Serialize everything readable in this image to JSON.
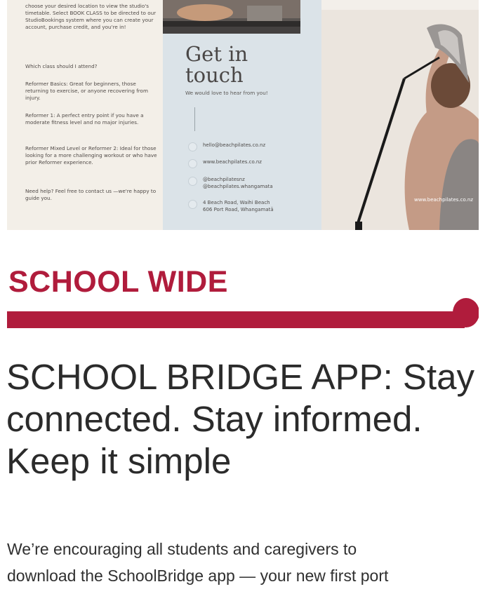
{
  "flyer": {
    "left_paragraphs": [
      "choose your desired location to view the studio's timetable. Select BOOK CLASS to be directed to our StudioBookings system where you can create your account, purchase credit, and you're in!",
      "Which class should I attend?",
      "Reformer Basics: Great for beginners, those returning to exercise, or anyone recovering from injury.",
      "Reformer 1: A perfect entry point if you have a moderate fitness level and no major injuries.",
      "Reformer Mixed Level or Reformer 2: Ideal for those looking for a more challenging workout or who have prior Reformer experience.",
      "Need help? Feel free to contact us —we're happy to guide you."
    ],
    "get_in_touch": "Get in touch",
    "subtitle": "We would love to hear from you!",
    "contacts": [
      {
        "icon": "email-icon",
        "text": "hello@beachpilates.co.nz"
      },
      {
        "icon": "globe-icon",
        "text": "www.beachpilates.co.nz"
      },
      {
        "icon": "instagram-icon",
        "text": "@beachpilatesnz\n@beachpilates.whangamata"
      },
      {
        "icon": "location-icon",
        "text": "4 Beach Road, Waihi Beach\n606 Port Road, Whangamatā"
      }
    ],
    "website_overlay": "www.beachpilates.co.nz"
  },
  "section": {
    "title": "SCHOOL WIDE",
    "accent_color": "#b01c3c"
  },
  "article": {
    "headline": "SCHOOL BRIDGE APP: Stay connected. Stay informed. Keep it simple",
    "body_lines": [
      "We’re encouraging all students and caregivers to",
      "download the SchoolBridge app — your new first port"
    ]
  }
}
